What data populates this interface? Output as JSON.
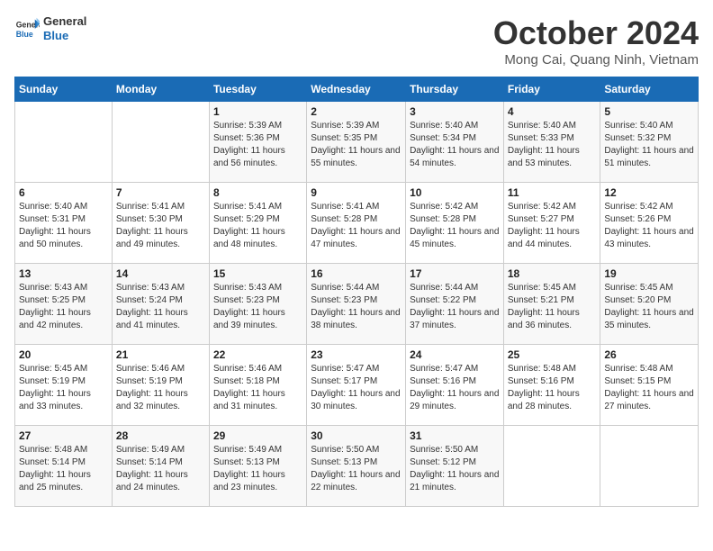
{
  "header": {
    "logo_line1": "General",
    "logo_line2": "Blue",
    "month_title": "October 2024",
    "location": "Mong Cai, Quang Ninh, Vietnam"
  },
  "weekdays": [
    "Sunday",
    "Monday",
    "Tuesday",
    "Wednesday",
    "Thursday",
    "Friday",
    "Saturday"
  ],
  "weeks": [
    [
      {
        "day": "",
        "info": ""
      },
      {
        "day": "",
        "info": ""
      },
      {
        "day": "1",
        "info": "Sunrise: 5:39 AM\nSunset: 5:36 PM\nDaylight: 11 hours and 56 minutes."
      },
      {
        "day": "2",
        "info": "Sunrise: 5:39 AM\nSunset: 5:35 PM\nDaylight: 11 hours and 55 minutes."
      },
      {
        "day": "3",
        "info": "Sunrise: 5:40 AM\nSunset: 5:34 PM\nDaylight: 11 hours and 54 minutes."
      },
      {
        "day": "4",
        "info": "Sunrise: 5:40 AM\nSunset: 5:33 PM\nDaylight: 11 hours and 53 minutes."
      },
      {
        "day": "5",
        "info": "Sunrise: 5:40 AM\nSunset: 5:32 PM\nDaylight: 11 hours and 51 minutes."
      }
    ],
    [
      {
        "day": "6",
        "info": "Sunrise: 5:40 AM\nSunset: 5:31 PM\nDaylight: 11 hours and 50 minutes."
      },
      {
        "day": "7",
        "info": "Sunrise: 5:41 AM\nSunset: 5:30 PM\nDaylight: 11 hours and 49 minutes."
      },
      {
        "day": "8",
        "info": "Sunrise: 5:41 AM\nSunset: 5:29 PM\nDaylight: 11 hours and 48 minutes."
      },
      {
        "day": "9",
        "info": "Sunrise: 5:41 AM\nSunset: 5:28 PM\nDaylight: 11 hours and 47 minutes."
      },
      {
        "day": "10",
        "info": "Sunrise: 5:42 AM\nSunset: 5:28 PM\nDaylight: 11 hours and 45 minutes."
      },
      {
        "day": "11",
        "info": "Sunrise: 5:42 AM\nSunset: 5:27 PM\nDaylight: 11 hours and 44 minutes."
      },
      {
        "day": "12",
        "info": "Sunrise: 5:42 AM\nSunset: 5:26 PM\nDaylight: 11 hours and 43 minutes."
      }
    ],
    [
      {
        "day": "13",
        "info": "Sunrise: 5:43 AM\nSunset: 5:25 PM\nDaylight: 11 hours and 42 minutes."
      },
      {
        "day": "14",
        "info": "Sunrise: 5:43 AM\nSunset: 5:24 PM\nDaylight: 11 hours and 41 minutes."
      },
      {
        "day": "15",
        "info": "Sunrise: 5:43 AM\nSunset: 5:23 PM\nDaylight: 11 hours and 39 minutes."
      },
      {
        "day": "16",
        "info": "Sunrise: 5:44 AM\nSunset: 5:23 PM\nDaylight: 11 hours and 38 minutes."
      },
      {
        "day": "17",
        "info": "Sunrise: 5:44 AM\nSunset: 5:22 PM\nDaylight: 11 hours and 37 minutes."
      },
      {
        "day": "18",
        "info": "Sunrise: 5:45 AM\nSunset: 5:21 PM\nDaylight: 11 hours and 36 minutes."
      },
      {
        "day": "19",
        "info": "Sunrise: 5:45 AM\nSunset: 5:20 PM\nDaylight: 11 hours and 35 minutes."
      }
    ],
    [
      {
        "day": "20",
        "info": "Sunrise: 5:45 AM\nSunset: 5:19 PM\nDaylight: 11 hours and 33 minutes."
      },
      {
        "day": "21",
        "info": "Sunrise: 5:46 AM\nSunset: 5:19 PM\nDaylight: 11 hours and 32 minutes."
      },
      {
        "day": "22",
        "info": "Sunrise: 5:46 AM\nSunset: 5:18 PM\nDaylight: 11 hours and 31 minutes."
      },
      {
        "day": "23",
        "info": "Sunrise: 5:47 AM\nSunset: 5:17 PM\nDaylight: 11 hours and 30 minutes."
      },
      {
        "day": "24",
        "info": "Sunrise: 5:47 AM\nSunset: 5:16 PM\nDaylight: 11 hours and 29 minutes."
      },
      {
        "day": "25",
        "info": "Sunrise: 5:48 AM\nSunset: 5:16 PM\nDaylight: 11 hours and 28 minutes."
      },
      {
        "day": "26",
        "info": "Sunrise: 5:48 AM\nSunset: 5:15 PM\nDaylight: 11 hours and 27 minutes."
      }
    ],
    [
      {
        "day": "27",
        "info": "Sunrise: 5:48 AM\nSunset: 5:14 PM\nDaylight: 11 hours and 25 minutes."
      },
      {
        "day": "28",
        "info": "Sunrise: 5:49 AM\nSunset: 5:14 PM\nDaylight: 11 hours and 24 minutes."
      },
      {
        "day": "29",
        "info": "Sunrise: 5:49 AM\nSunset: 5:13 PM\nDaylight: 11 hours and 23 minutes."
      },
      {
        "day": "30",
        "info": "Sunrise: 5:50 AM\nSunset: 5:13 PM\nDaylight: 11 hours and 22 minutes."
      },
      {
        "day": "31",
        "info": "Sunrise: 5:50 AM\nSunset: 5:12 PM\nDaylight: 11 hours and 21 minutes."
      },
      {
        "day": "",
        "info": ""
      },
      {
        "day": "",
        "info": ""
      }
    ]
  ]
}
